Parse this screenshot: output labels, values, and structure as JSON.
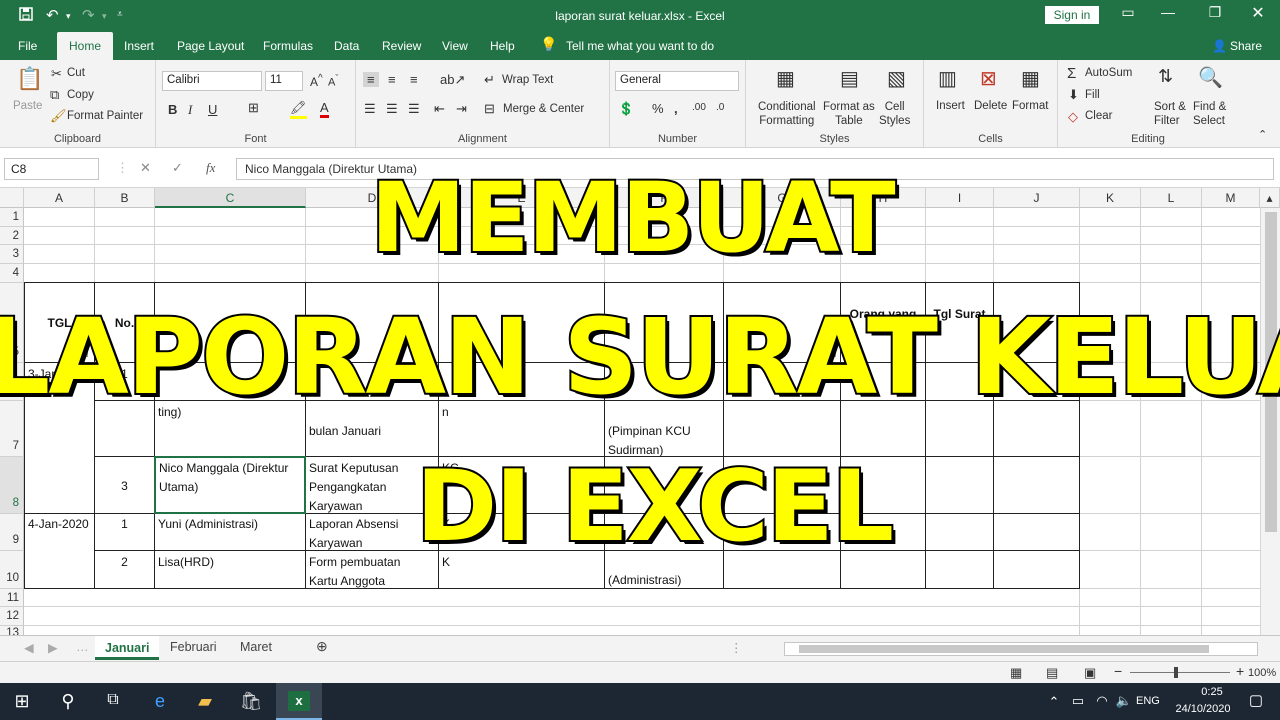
{
  "window": {
    "title": "laporan surat keluar.xlsx  -  Excel",
    "sign_in": "Sign in",
    "share": "Share"
  },
  "ribbon_tabs": [
    "File",
    "Home",
    "Insert",
    "Page Layout",
    "Formulas",
    "Data",
    "Review",
    "View",
    "Help",
    "Tell me what you want to do"
  ],
  "ribbon": {
    "clipboard": {
      "label": "Clipboard",
      "paste": "Paste",
      "cut": "Cut",
      "copy": "Copy",
      "format_painter": "Format Painter"
    },
    "font": {
      "label": "Font",
      "name": "Calibri",
      "size": "11"
    },
    "alignment": {
      "label": "Alignment",
      "wrap_text": "Wrap Text",
      "merge_center": "Merge & Center"
    },
    "number": {
      "label": "Number",
      "format": "General"
    },
    "styles": {
      "label": "Styles",
      "conditional_1": "Conditional",
      "conditional_2": "Formatting",
      "table_1": "Format as",
      "table_2": "Table",
      "cell_1": "Cell",
      "cell_2": "Styles"
    },
    "cells": {
      "label": "Cells",
      "insert": "Insert",
      "delete": "Delete",
      "format": "Format"
    },
    "editing": {
      "label": "Editing",
      "autosum": "AutoSum",
      "fill": "Fill",
      "clear": "Clear",
      "sort_1": "Sort &",
      "sort_2": "Filter",
      "find_1": "Find &",
      "find_2": "Select"
    }
  },
  "formula_bar": {
    "name_box": "C8",
    "content": "Nico Manggala (Direktur Utama)"
  },
  "grid": {
    "columns": [
      "A",
      "B",
      "C",
      "D",
      "E",
      "F",
      "G",
      "H",
      "I",
      "J",
      "K",
      "L",
      "M"
    ],
    "rows": [
      "1",
      "2",
      "3",
      "4",
      "5",
      "6",
      "7",
      "8",
      "9",
      "10",
      "11",
      "12",
      "13"
    ],
    "table": {
      "headers": [
        "TGL",
        "No.",
        "",
        "",
        "",
        "",
        "",
        "Orang yang",
        "Tgl Surat",
        ""
      ],
      "row6": {
        "date": "3-Jan-2020",
        "no": "1"
      },
      "row7": {
        "name": "ting)",
        "subject": "bulan Januari",
        "destination": "n",
        "receiver_1": "(Pimpinan KCU",
        "receiver_2": "Sudirman)"
      },
      "row8": {
        "no": "3",
        "name_1": "Nico Manggala (Direktur",
        "name_2": "Utama)",
        "subject_1": "Surat Keputusan",
        "subject_2": "Pengangkatan",
        "subject_3": "Karyawan",
        "destination": "KC"
      },
      "row9": {
        "date": "4-Jan-2020",
        "no": "1",
        "name": "Yuni (Administrasi)",
        "subject_1": "Laporan Absensi",
        "subject_2": "Karyawan",
        "destination": "K"
      },
      "row10": {
        "no": "2",
        "name": "Lisa(HRD)",
        "subject_1": "Form pembuatan",
        "subject_2": "Kartu Anggota",
        "destination": "K",
        "receiver": "(Administrasi)"
      }
    }
  },
  "sheets": [
    "Januari",
    "Februari",
    "Maret"
  ],
  "status": {
    "zoom": "100%"
  },
  "taskbar": {
    "lang": "ENG",
    "time": "0:25",
    "date": "24/10/2020"
  },
  "overlay": {
    "line1": "MEMBUAT",
    "line2": "LAPORAN SURAT KELUAR",
    "line3": "DI EXCEL"
  }
}
